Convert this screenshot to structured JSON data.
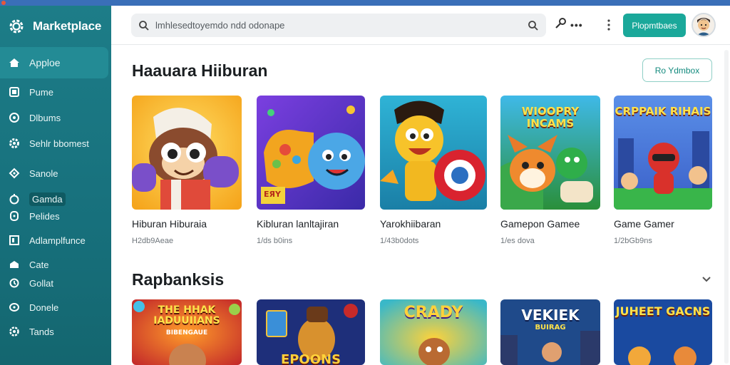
{
  "sidebar": {
    "brand": "Marketplace",
    "items": [
      {
        "label": "Apploe",
        "icon": "home-icon"
      },
      {
        "label": "Pume",
        "icon": "bookmark-icon"
      },
      {
        "label": "Dlbums",
        "icon": "compass-icon"
      },
      {
        "label": "Sehlr bbomest",
        "icon": "gear-icon"
      },
      {
        "label": "Sanole",
        "icon": "tag-icon"
      },
      {
        "label": "Gamda",
        "icon": "gamepad-icon"
      },
      {
        "label": "Pelides",
        "icon": "clock-icon"
      },
      {
        "label": "Adlamplfunce",
        "icon": "grid-icon"
      },
      {
        "label": "Cate",
        "icon": "folder-icon"
      },
      {
        "label": "Gollat",
        "icon": "refresh-icon"
      },
      {
        "label": "Donele",
        "icon": "globe-icon"
      },
      {
        "label": "Tands",
        "icon": "settings-icon"
      }
    ]
  },
  "header": {
    "search_text": "lmhlesedtoyemdo ndd odonape",
    "cta_label": "Plopmtbaes",
    "icons": [
      "search-icon",
      "key-icon",
      "more-icon",
      "kebab-icon",
      "avatar"
    ]
  },
  "sections": [
    {
      "title": "Haauara Hiiburan",
      "view_all": "Ro Ydmbox",
      "cards": [
        {
          "title": "Hiburan Hiburaia",
          "sub": "H2db9Aeae",
          "art": "ninja-character"
        },
        {
          "title": "Kibluran lanltajiran",
          "sub": "1/ds b0ins",
          "art": "gamepad-faces",
          "badge": "EЯY"
        },
        {
          "title": "Yarokhiibaran",
          "sub": "1/43b0dots",
          "art": "yellow-hero"
        },
        {
          "title": "Gamepon Gamee",
          "sub": "1/es dova",
          "art": "fox-game",
          "art_title": "WIOOPRY INCAMS"
        },
        {
          "title": "Game Gamer",
          "sub": "1/2bGb9ns",
          "art": "city-characters",
          "art_title": "CRPPAIK RIHAIS"
        }
      ]
    },
    {
      "title": "Rapbanksis",
      "cards": [
        {
          "art": "burst-title",
          "art_title": "THE HHAK IADUUIIANS",
          "art_sub": "BIBENGAUE"
        },
        {
          "art": "character-frame",
          "art_title": "EPOONS"
        },
        {
          "art": "cartoon-burst",
          "art_title": "CRADY"
        },
        {
          "art": "city-night",
          "art_title": "VEKIEK",
          "art_sub": "BUIRAG"
        },
        {
          "art": "cat-cartoon",
          "art_title": "JUHEET GACNS"
        }
      ]
    }
  ]
}
